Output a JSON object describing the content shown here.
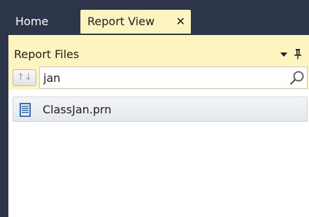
{
  "tabs": {
    "home_label": "Home",
    "report_view_label": "Report View",
    "close_glyph": "✕"
  },
  "panel": {
    "title": "Report Files",
    "sort_glyph": "↑↓"
  },
  "search": {
    "value": "jan",
    "placeholder": ""
  },
  "files": [
    {
      "name": "ClassJan.prn",
      "icon": "document-icon"
    }
  ],
  "colors": {
    "frame_background": "#2c3549",
    "active_tab_background": "#fdf4bf",
    "panel_header_background": "#fdf4bf",
    "file_icon": "#2a6fc0"
  }
}
